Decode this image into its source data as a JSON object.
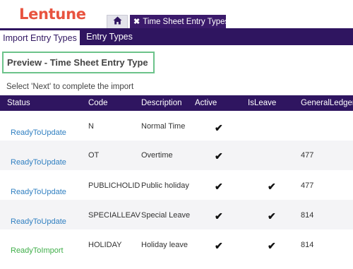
{
  "brand": {
    "logo_text": "Lentune",
    "logo_color": "#e8533f"
  },
  "tabs": {
    "home_icon": "home-icon",
    "document_tab_close": "✖",
    "document_tab_label": "Time Sheet Entry Types"
  },
  "subnav": {
    "active_label": "Import Entry Types",
    "inactive_label": "Entry Types"
  },
  "preview": {
    "title": "Preview - Time Sheet Entry Type"
  },
  "instructions": "Select 'Next' to complete the import",
  "table": {
    "headers": [
      "Status",
      "Code",
      "Description",
      "Active",
      "IsLeave",
      "GeneralLedgerAc"
    ],
    "rows": [
      {
        "status": "ReadyToUpdate",
        "code": "N",
        "description": "Normal Time",
        "active": "✔",
        "is_leave": "",
        "gl": ""
      },
      {
        "status": "ReadyToUpdate",
        "code": "OT",
        "description": "Overtime",
        "active": "✔",
        "is_leave": "",
        "gl": "477"
      },
      {
        "status": "ReadyToUpdate",
        "code": "PUBLICHOLID...",
        "description": "Public holiday",
        "active": "✔",
        "is_leave": "✔",
        "gl": "477"
      },
      {
        "status": "ReadyToUpdate",
        "code": "SPECIALLEAVE",
        "description": "Special Leave",
        "active": "✔",
        "is_leave": "✔",
        "gl": "814"
      },
      {
        "status": "ReadyToImport",
        "code": "HOLIDAY",
        "description": "Holiday leave",
        "active": "✔",
        "is_leave": "✔",
        "gl": "814"
      }
    ]
  },
  "colors": {
    "header_bg": "#2f1560",
    "status_update": "#2f7fc1",
    "status_import": "#3fae49",
    "preview_border": "#6cc38a"
  }
}
